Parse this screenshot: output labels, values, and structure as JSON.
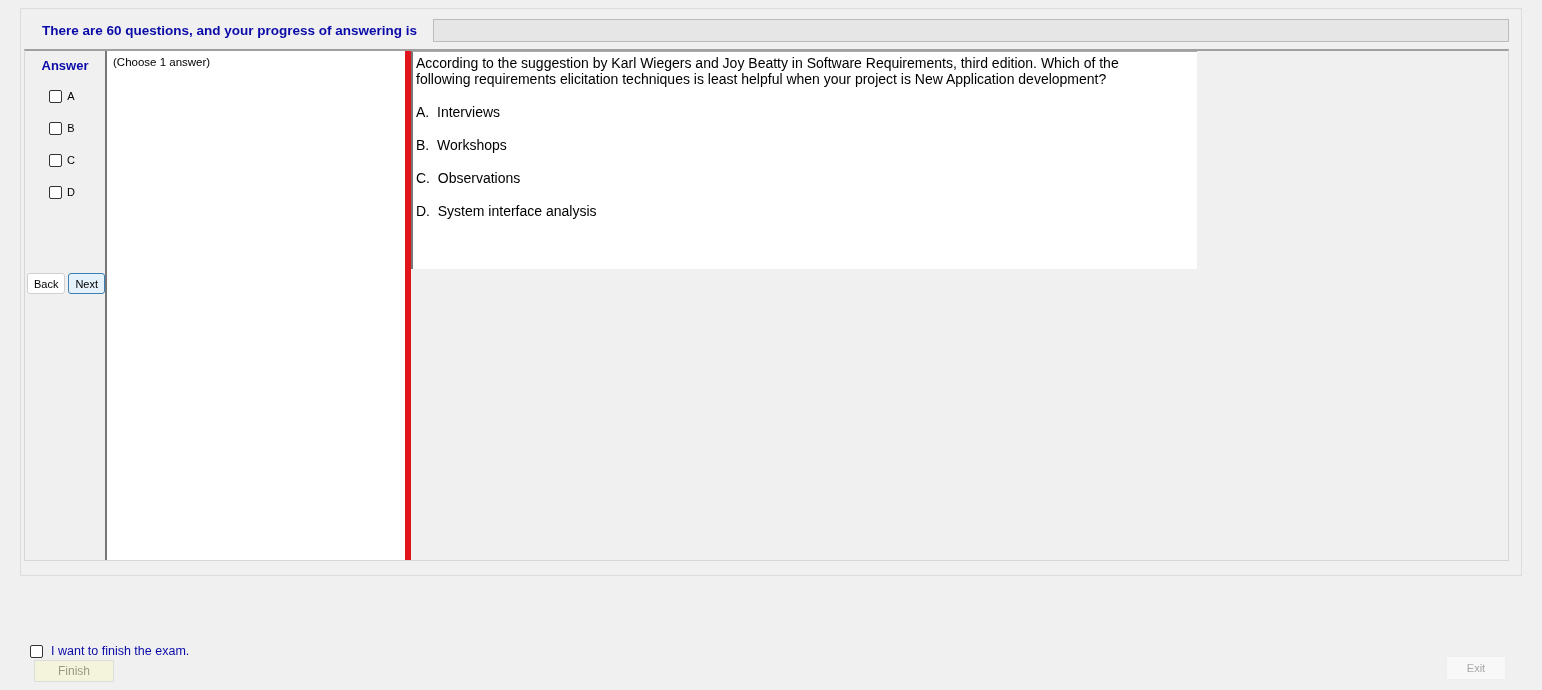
{
  "header": {
    "text": "There are 60 questions, and your progress of answering is",
    "progress": {
      "level": 0
    }
  },
  "answer": {
    "title": "Answer",
    "options": [
      {
        "label": "A",
        "checked": false
      },
      {
        "label": "B",
        "checked": false
      },
      {
        "label": "C",
        "checked": false
      },
      {
        "label": "D",
        "checked": false
      }
    ]
  },
  "navigation": [
    {
      "label": "Back",
      "selected": false
    },
    {
      "label": "Next",
      "selected": true
    }
  ],
  "instruction": "(Choose 1 answer)",
  "question": {
    "text": "According to the suggestion by Karl Wiegers and Joy Beatty in Software Requirements, third edition.  Which of the following requirements elicitation techniques is least helpful when your project is New Application development?",
    "choices": [
      "A.  Interviews",
      "B.  Workshops",
      "C.  Observations",
      "D.  System interface analysis"
    ]
  },
  "finish": {
    "label": "I want to finish the exam.",
    "checked": false,
    "button": {
      "label": "Finish",
      "disabled": true
    }
  },
  "exit": {
    "label": "Exit",
    "disabled": true
  }
}
